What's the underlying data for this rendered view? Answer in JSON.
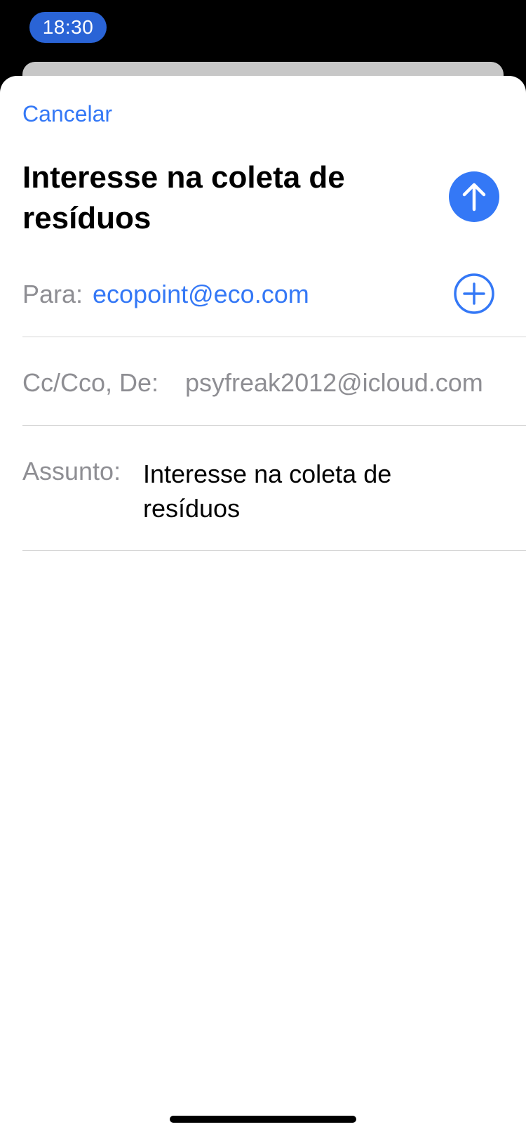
{
  "status_bar": {
    "time": "18:30"
  },
  "compose": {
    "cancel_label": "Cancelar",
    "title": "Interesse na coleta de resíduos",
    "to_label": "Para:",
    "to_value": "ecopoint@eco.com",
    "cc_label": "Cc/Cco, De:",
    "cc_value": "psyfreak2012@icloud.com",
    "subject_label": "Assunto:",
    "subject_value": "Interesse na coleta de resíduos"
  },
  "icons": {
    "send": "arrow-up-circle-icon",
    "add_recipient": "plus-circle-icon"
  },
  "colors": {
    "accent": "#3478f6",
    "time_pill": "#2a64d6",
    "label_gray": "#8e8e93",
    "separator": "#d6d6d6"
  }
}
